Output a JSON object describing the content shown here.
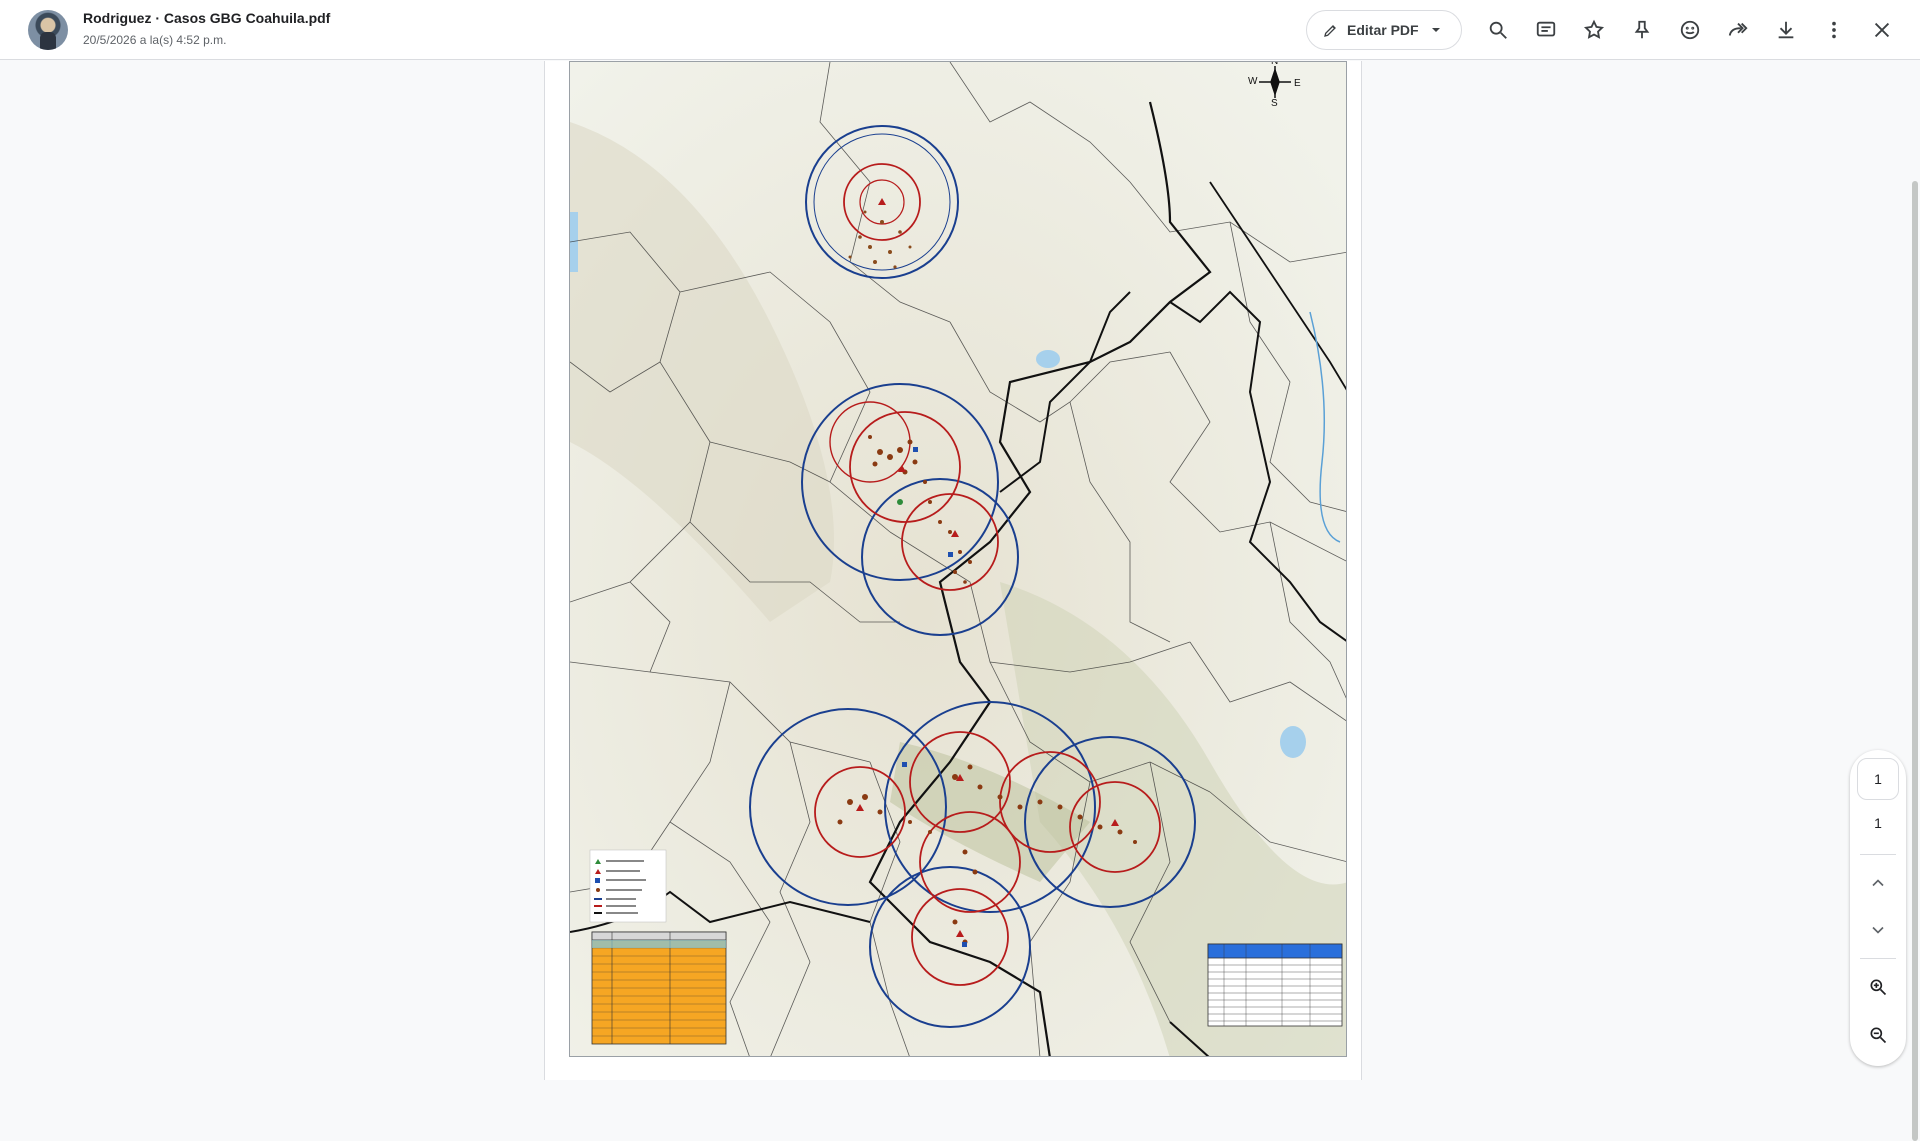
{
  "header": {
    "title": "Rodriguez · Casos GBG Coahuila.pdf",
    "date": "20/5/2026 a la(s) 4:52 p.m.",
    "edit_label": "Editar PDF"
  },
  "toolbar": {
    "icons": [
      "search-icon",
      "comment-icon",
      "star-icon",
      "pin-icon",
      "emoji-icon",
      "forward-icon",
      "download-icon",
      "more-vert-icon",
      "close-icon"
    ]
  },
  "map": {
    "compass": {
      "n": "N",
      "s": "S",
      "e": "E",
      "w": "W"
    }
  },
  "page_nav": {
    "current": "1",
    "total": "1"
  },
  "colors": {
    "accent_blue": "#1a3f8f",
    "accent_red": "#b71c1c",
    "table_orange": "#f6a623",
    "table_blue": "#2a6fdb"
  }
}
